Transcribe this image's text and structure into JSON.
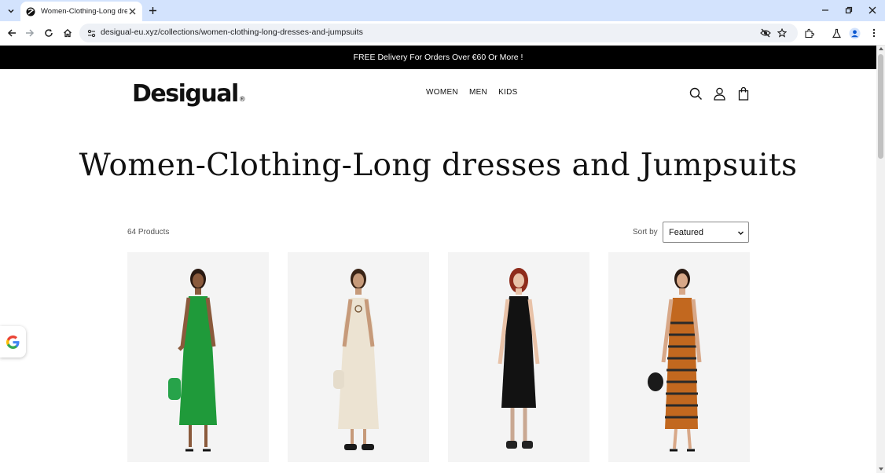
{
  "browser": {
    "tab_title": "Women-Clothing-Long dresses and Jumpsuits",
    "url": "desigual-eu.xyz/collections/women-clothing-long-dresses-and-jumpsuits"
  },
  "announcement": {
    "text": "FREE Delivery For Orders Over €60 Or More !"
  },
  "header": {
    "logo_text": "Desigual",
    "logo_mark": "®",
    "nav": [
      "WOMEN",
      "MEN",
      "KIDS"
    ]
  },
  "collection": {
    "title": "Women-Clothing-Long dresses and Jumpsuits",
    "product_count": "64 Products",
    "sort_label": "Sort by",
    "sort_value": "Featured"
  },
  "products": [
    {
      "name": "green-strappy-long-dress",
      "dress_color": "#1f9a3a",
      "bag_color": "#27a34a"
    },
    {
      "name": "cream-halter-long-dress",
      "dress_color": "#ece3d2",
      "bag_color": "#e5dccb"
    },
    {
      "name": "black-sleeveless-midi-dress",
      "dress_color": "#121212",
      "bag_color": "#121212"
    },
    {
      "name": "striped-knit-long-dress",
      "dress_color": "#c2681f",
      "bag_color": "#1a1a1a"
    }
  ],
  "colors": {
    "tabstrip": "#d3e3fd",
    "announcement_bg": "#000000",
    "announcement_text": "#ffffff",
    "card_bg": "#f4f4f4"
  }
}
